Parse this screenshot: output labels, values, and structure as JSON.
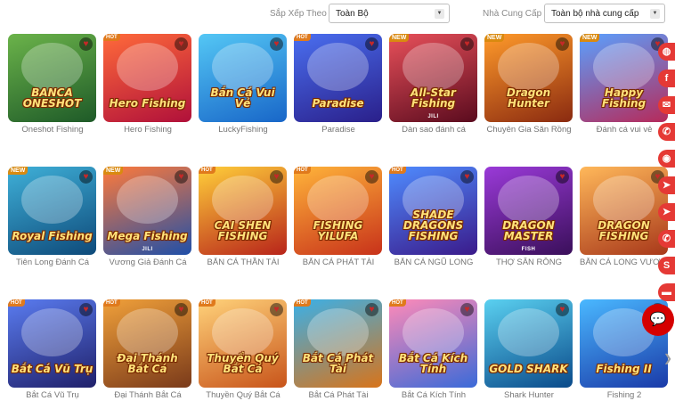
{
  "filters": {
    "sort_label": "Sắp Xếp Theo",
    "sort_value": "Toàn Bộ",
    "provider_label": "Nhà Cung Cấp",
    "provider_value": "Toàn bộ nhà cung cấp"
  },
  "games": [
    {
      "name": "Oneshot Fishing",
      "logo": "BANCA ONESHOT",
      "badge": "",
      "provider": "",
      "colors": [
        "#6bb34a",
        "#1e5a28"
      ]
    },
    {
      "name": "Hero Fishing",
      "logo": "Hero Fishing",
      "badge": "HOT",
      "provider": "",
      "colors": [
        "#ff6a3a",
        "#b0103a"
      ]
    },
    {
      "name": "LuckyFishing",
      "logo": "Bắn Cá Vui Vẻ",
      "badge": "",
      "provider": "",
      "colors": [
        "#54c7f5",
        "#1866c8"
      ]
    },
    {
      "name": "Paradise",
      "logo": "Paradise",
      "badge": "HOT",
      "provider": "",
      "colors": [
        "#4a6ff0",
        "#2a1f8a"
      ]
    },
    {
      "name": "Dàn sao đánh cá",
      "logo": "All-Star Fishing",
      "badge": "NEW",
      "provider": "JILI",
      "colors": [
        "#e8505a",
        "#5a0b1e"
      ]
    },
    {
      "name": "Chuyên Gia Săn Rồng",
      "logo": "Dragon Hunter",
      "badge": "NEW",
      "provider": "",
      "colors": [
        "#ff9a2a",
        "#8a2a10"
      ]
    },
    {
      "name": "Đánh cá vui vẻ",
      "logo": "Happy Fishing",
      "badge": "NEW",
      "provider": "",
      "colors": [
        "#5aa0ff",
        "#b62a5a"
      ]
    },
    {
      "name": "Tiên Long Đánh Cá",
      "logo": "Royal Fishing",
      "badge": "NEW",
      "provider": "",
      "colors": [
        "#3fb0d8",
        "#0e4a7a"
      ]
    },
    {
      "name": "Vương Giả Đánh Cá",
      "logo": "Mega Fishing",
      "badge": "NEW",
      "provider": "JILI",
      "colors": [
        "#ff7a3a",
        "#1f4fa8"
      ]
    },
    {
      "name": "BẮN CÁ THẦN TÀI",
      "logo": "CAI SHEN FISHING",
      "badge": "HOT",
      "provider": "",
      "colors": [
        "#ffcf3a",
        "#b8241a"
      ]
    },
    {
      "name": "BẮN CÁ PHÁT TÀI",
      "logo": "FISHING YILUFA",
      "badge": "HOT",
      "provider": "",
      "colors": [
        "#ffb43a",
        "#c8321a"
      ]
    },
    {
      "name": "BẮN CÁ NGŨ LONG",
      "logo": "SHADE DRAGONS FISHING",
      "badge": "HOT",
      "provider": "",
      "colors": [
        "#4f8cff",
        "#3a1a8a"
      ]
    },
    {
      "name": "THỢ SĂN RỒNG",
      "logo": "DRAGON MASTER",
      "badge": "",
      "provider": "FISH",
      "colors": [
        "#9a3ad8",
        "#3a0f5a"
      ]
    },
    {
      "name": "BẮN CÁ LONG VƯƠNG",
      "logo": "DRAGON FISHING",
      "badge": "",
      "provider": "",
      "colors": [
        "#ffb85a",
        "#a8381a"
      ]
    },
    {
      "name": "Bắt Cá Vũ Trụ",
      "logo": "Bắt Cá Vũ Trụ",
      "badge": "HOT",
      "provider": "",
      "colors": [
        "#5a7cf0",
        "#20206a"
      ]
    },
    {
      "name": "Đại Thánh Bắt Cá",
      "logo": "Đại Thánh Bắt Cá",
      "badge": "HOT",
      "provider": "",
      "colors": [
        "#f0a03a",
        "#7a3a1a"
      ]
    },
    {
      "name": "Thuyền Quý Bắt Cá",
      "logo": "Thuyền Quý Bắt Cá",
      "badge": "HOT",
      "provider": "",
      "colors": [
        "#ffd27a",
        "#c8541a"
      ]
    },
    {
      "name": "Bắt Cá Phát Tài",
      "logo": "Bắt Cá Phát Tài",
      "badge": "HOT",
      "provider": "",
      "colors": [
        "#3ab0e8",
        "#d8741a"
      ]
    },
    {
      "name": "Bắt Cá Kích Tính",
      "logo": "Bắt Cá Kích Tính",
      "badge": "HOT",
      "provider": "",
      "colors": [
        "#ff8ab8",
        "#3a6ad8"
      ]
    },
    {
      "name": "Shark Hunter",
      "logo": "GOLD SHARK",
      "badge": "",
      "provider": "",
      "colors": [
        "#5ad0f0",
        "#0a4a8a"
      ]
    },
    {
      "name": "Fishing 2",
      "logo": "Fishing II",
      "badge": "",
      "provider": "",
      "colors": [
        "#4ab8ff",
        "#1a3aa8"
      ]
    }
  ],
  "sidebar": [
    {
      "icon": "chat-bubble-icon",
      "glyph": "◍",
      "color": "#e53935"
    },
    {
      "icon": "facebook-icon",
      "glyph": "f",
      "color": "#e53935"
    },
    {
      "icon": "messenger-icon",
      "glyph": "✉",
      "color": "#e53935"
    },
    {
      "icon": "whatsapp-icon",
      "glyph": "✆",
      "color": "#e53935"
    },
    {
      "icon": "wechat-icon",
      "glyph": "◉",
      "color": "#e53935"
    },
    {
      "icon": "telegram-icon",
      "glyph": "➤",
      "color": "#e53935"
    },
    {
      "icon": "telegram-icon",
      "glyph": "➤",
      "color": "#e53935"
    },
    {
      "icon": "phone-icon",
      "glyph": "✆",
      "color": "#e53935"
    },
    {
      "icon": "skype-icon",
      "glyph": "S",
      "color": "#e53935"
    },
    {
      "icon": "line-icon",
      "glyph": "▬",
      "color": "#e53935"
    }
  ],
  "colors": {
    "accent": "#e53935",
    "chat_button": "#d50000",
    "favorite": "#c62828"
  }
}
